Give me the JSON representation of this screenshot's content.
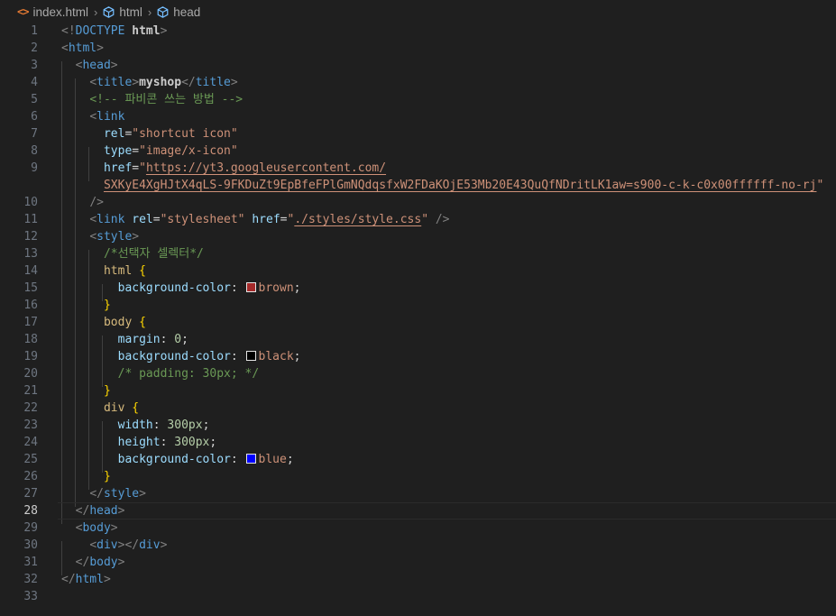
{
  "breadcrumb": {
    "file": "index.html",
    "file_icon": "<>",
    "items": [
      "html",
      "head"
    ]
  },
  "colors": {
    "brown": "#a52a2a",
    "black": "#000000",
    "blue": "#0000ff"
  },
  "lines": [
    {
      "n": "1",
      "tokens": [
        [
          "t-punc",
          "<!"
        ],
        [
          "t-tag",
          "DOCTYPE "
        ],
        [
          "t-bold",
          "html"
        ],
        [
          "t-punc",
          ">"
        ]
      ]
    },
    {
      "n": "2",
      "tokens": [
        [
          "t-punc",
          "<"
        ],
        [
          "t-tag",
          "html"
        ],
        [
          "t-punc",
          ">"
        ]
      ]
    },
    {
      "n": "3",
      "tokens": [
        [
          "t-text",
          "  "
        ],
        [
          "t-punc",
          "<"
        ],
        [
          "t-tag",
          "head"
        ],
        [
          "t-punc",
          ">"
        ]
      ]
    },
    {
      "n": "4",
      "tokens": [
        [
          "t-text",
          "    "
        ],
        [
          "t-punc",
          "<"
        ],
        [
          "t-tag",
          "title"
        ],
        [
          "t-punc",
          ">"
        ],
        [
          "t-bold",
          "myshop"
        ],
        [
          "t-punc",
          "</"
        ],
        [
          "t-tag",
          "title"
        ],
        [
          "t-punc",
          ">"
        ]
      ]
    },
    {
      "n": "5",
      "tokens": [
        [
          "t-text",
          "    "
        ],
        [
          "t-comment",
          "<!-- 파비콘 쓰는 방법 -->"
        ]
      ]
    },
    {
      "n": "6",
      "tokens": [
        [
          "t-text",
          "    "
        ],
        [
          "t-punc",
          "<"
        ],
        [
          "t-tag",
          "link"
        ]
      ]
    },
    {
      "n": "7",
      "tokens": [
        [
          "t-text",
          "      "
        ],
        [
          "t-attr",
          "rel"
        ],
        [
          "t-op",
          "="
        ],
        [
          "t-str",
          "\"shortcut icon\""
        ]
      ]
    },
    {
      "n": "8",
      "tokens": [
        [
          "t-text",
          "      "
        ],
        [
          "t-attr",
          "type"
        ],
        [
          "t-op",
          "="
        ],
        [
          "t-str",
          "\"image/x-icon\""
        ]
      ]
    },
    {
      "n": "9",
      "tokens": [
        [
          "t-text",
          "      "
        ],
        [
          "t-attr",
          "href"
        ],
        [
          "t-op",
          "="
        ],
        [
          "t-str",
          "\""
        ],
        [
          "t-link",
          "https://yt3.googleusercontent.com/"
        ]
      ]
    },
    {
      "n": "",
      "tokens": [
        [
          "t-text",
          "      "
        ],
        [
          "t-link",
          "SXKyE4XgHJtX4qLS-9FKDuZt9EpBfeFPlGmNQdqsfxW2FDaKOjE53Mb20E43QuQfNDritLK1aw=s900-c-k-c0x00ffffff-no-rj"
        ],
        [
          "t-str",
          "\""
        ]
      ]
    },
    {
      "n": "10",
      "tokens": [
        [
          "t-text",
          "    "
        ],
        [
          "t-punc",
          "/>"
        ]
      ]
    },
    {
      "n": "11",
      "tokens": [
        [
          "t-text",
          "    "
        ],
        [
          "t-punc",
          "<"
        ],
        [
          "t-tag",
          "link "
        ],
        [
          "t-attr",
          "rel"
        ],
        [
          "t-op",
          "="
        ],
        [
          "t-str",
          "\"stylesheet\" "
        ],
        [
          "t-attr",
          "href"
        ],
        [
          "t-op",
          "="
        ],
        [
          "t-str",
          "\""
        ],
        [
          "t-link",
          "./styles/style.css"
        ],
        [
          "t-str",
          "\" "
        ],
        [
          "t-punc",
          "/>"
        ]
      ]
    },
    {
      "n": "12",
      "tokens": [
        [
          "t-text",
          "    "
        ],
        [
          "t-punc",
          "<"
        ],
        [
          "t-tag",
          "style"
        ],
        [
          "t-punc",
          ">"
        ]
      ]
    },
    {
      "n": "13",
      "tokens": [
        [
          "t-text",
          "      "
        ],
        [
          "t-comment",
          "/*선택자 셀렉터*/"
        ]
      ]
    },
    {
      "n": "14",
      "tokens": [
        [
          "t-text",
          "      "
        ],
        [
          "t-sel",
          "html "
        ],
        [
          "t-brace",
          "{"
        ]
      ]
    },
    {
      "n": "15",
      "tokens": [
        [
          "t-text",
          "        "
        ],
        [
          "t-prop",
          "background-color"
        ],
        [
          "t-op",
          ": "
        ],
        [
          "swatch",
          "brown"
        ],
        [
          "t-str",
          "brown"
        ],
        [
          "t-op",
          ";"
        ]
      ]
    },
    {
      "n": "16",
      "tokens": [
        [
          "t-text",
          "      "
        ],
        [
          "t-brace",
          "}"
        ]
      ]
    },
    {
      "n": "17",
      "tokens": [
        [
          "t-text",
          "      "
        ],
        [
          "t-sel",
          "body "
        ],
        [
          "t-brace",
          "{"
        ]
      ]
    },
    {
      "n": "18",
      "tokens": [
        [
          "t-text",
          "        "
        ],
        [
          "t-prop",
          "margin"
        ],
        [
          "t-op",
          ": "
        ],
        [
          "t-num",
          "0"
        ],
        [
          "t-op",
          ";"
        ]
      ]
    },
    {
      "n": "19",
      "tokens": [
        [
          "t-text",
          "        "
        ],
        [
          "t-prop",
          "background-color"
        ],
        [
          "t-op",
          ": "
        ],
        [
          "swatch",
          "black"
        ],
        [
          "t-str",
          "black"
        ],
        [
          "t-op",
          ";"
        ]
      ]
    },
    {
      "n": "20",
      "tokens": [
        [
          "t-text",
          "        "
        ],
        [
          "t-comment",
          "/* padding: 30px; */"
        ]
      ]
    },
    {
      "n": "21",
      "tokens": [
        [
          "t-text",
          "      "
        ],
        [
          "t-brace",
          "}"
        ]
      ]
    },
    {
      "n": "22",
      "tokens": [
        [
          "t-text",
          "      "
        ],
        [
          "t-sel",
          "div "
        ],
        [
          "t-brace",
          "{"
        ]
      ]
    },
    {
      "n": "23",
      "tokens": [
        [
          "t-text",
          "        "
        ],
        [
          "t-prop",
          "width"
        ],
        [
          "t-op",
          ": "
        ],
        [
          "t-num",
          "300px"
        ],
        [
          "t-op",
          ";"
        ]
      ]
    },
    {
      "n": "24",
      "tokens": [
        [
          "t-text",
          "        "
        ],
        [
          "t-prop",
          "height"
        ],
        [
          "t-op",
          ": "
        ],
        [
          "t-num",
          "300px"
        ],
        [
          "t-op",
          ";"
        ]
      ]
    },
    {
      "n": "25",
      "tokens": [
        [
          "t-text",
          "        "
        ],
        [
          "t-prop",
          "background-color"
        ],
        [
          "t-op",
          ": "
        ],
        [
          "swatch",
          "blue"
        ],
        [
          "t-str",
          "blue"
        ],
        [
          "t-op",
          ";"
        ]
      ]
    },
    {
      "n": "26",
      "tokens": [
        [
          "t-text",
          "      "
        ],
        [
          "t-brace",
          "}"
        ]
      ]
    },
    {
      "n": "27",
      "tokens": [
        [
          "t-text",
          "    "
        ],
        [
          "t-punc",
          "</"
        ],
        [
          "t-tag",
          "style"
        ],
        [
          "t-punc",
          ">"
        ]
      ]
    },
    {
      "n": "28",
      "tokens": [
        [
          "t-text",
          "  "
        ],
        [
          "t-punc",
          "</"
        ],
        [
          "t-tag",
          "head"
        ],
        [
          "t-punc",
          ">"
        ]
      ]
    },
    {
      "n": "29",
      "tokens": [
        [
          "t-text",
          "  "
        ],
        [
          "t-punc",
          "<"
        ],
        [
          "t-tag",
          "body"
        ],
        [
          "t-punc",
          ">"
        ]
      ]
    },
    {
      "n": "30",
      "tokens": [
        [
          "t-text",
          "    "
        ],
        [
          "t-punc",
          "<"
        ],
        [
          "t-tag",
          "div"
        ],
        [
          "t-punc",
          "></"
        ],
        [
          "t-tag",
          "div"
        ],
        [
          "t-punc",
          ">"
        ]
      ]
    },
    {
      "n": "31",
      "tokens": [
        [
          "t-text",
          "  "
        ],
        [
          "t-punc",
          "</"
        ],
        [
          "t-tag",
          "body"
        ],
        [
          "t-punc",
          ">"
        ]
      ]
    },
    {
      "n": "32",
      "tokens": [
        [
          "t-punc",
          "</"
        ],
        [
          "t-tag",
          "html"
        ],
        [
          "t-punc",
          ">"
        ]
      ]
    },
    {
      "n": "33",
      "tokens": []
    }
  ],
  "current_line": "28"
}
